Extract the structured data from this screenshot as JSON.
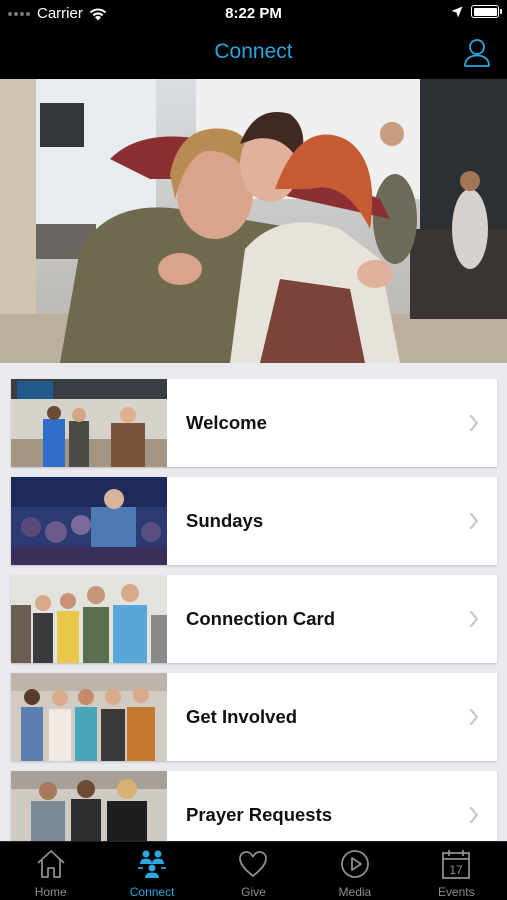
{
  "status_bar": {
    "carrier": "Carrier",
    "time": "8:22 PM",
    "icons": [
      "signal-dots-icon",
      "wifi-icon",
      "location-arrow-icon",
      "battery-icon"
    ]
  },
  "nav": {
    "title": "Connect",
    "right_icon": "profile-icon"
  },
  "hero": {
    "description_icon": "hero-photo"
  },
  "menu_items": [
    {
      "label": "Welcome"
    },
    {
      "label": "Sundays"
    },
    {
      "label": "Connection Card"
    },
    {
      "label": "Get Involved"
    },
    {
      "label": "Prayer Requests"
    }
  ],
  "tabs": [
    {
      "label": "Home",
      "icon": "house-icon",
      "active": false
    },
    {
      "label": "Connect",
      "icon": "people-icon",
      "active": true
    },
    {
      "label": "Give",
      "icon": "heart-icon",
      "active": false
    },
    {
      "label": "Media",
      "icon": "play-icon",
      "active": false
    },
    {
      "label": "Events",
      "icon": "calendar-icon",
      "active": false
    }
  ],
  "calendar_day": "17",
  "colors": {
    "accent": "#2aa6e0",
    "inactive_tab": "#8e8e93",
    "background_list": "#e9e9ee"
  }
}
